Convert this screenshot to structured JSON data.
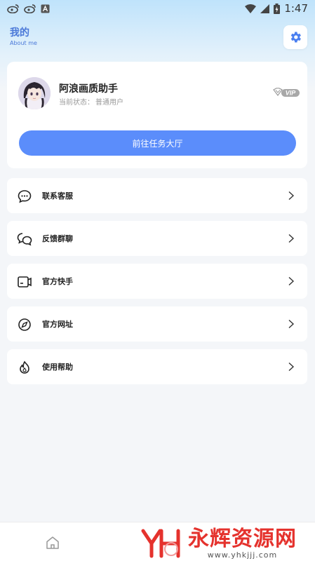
{
  "status_bar": {
    "time": "1:47",
    "left_icons": [
      "weibo-icon",
      "weibo-icon",
      "keyboard-a-icon"
    ],
    "right_icons": [
      "wifi-icon",
      "signal-icon",
      "battery-icon"
    ]
  },
  "header": {
    "title": "我的",
    "subtitle": "About me",
    "settings_icon": "gear-icon"
  },
  "profile": {
    "name": "阿浪画质助手",
    "status_label": "当前状态：",
    "status_value": "普通用户",
    "vip_label": "VIP",
    "task_button": "前往任务大厅"
  },
  "menu": [
    {
      "label": "联系客服",
      "icon": "chat-bubble-icon"
    },
    {
      "label": "反馈群聊",
      "icon": "group-chat-icon"
    },
    {
      "label": "官方快手",
      "icon": "video-card-icon"
    },
    {
      "label": "官方网址",
      "icon": "compass-icon"
    },
    {
      "label": "使用帮助",
      "icon": "help-flame-icon"
    }
  ],
  "bottom_nav": {
    "home_icon": "home-icon"
  },
  "watermark": {
    "text": "永辉资源网",
    "url": "www.yhkjjj.com"
  },
  "colors": {
    "accent": "#5b8dfb",
    "title": "#4a78d8",
    "watermark": "#e5322d"
  }
}
